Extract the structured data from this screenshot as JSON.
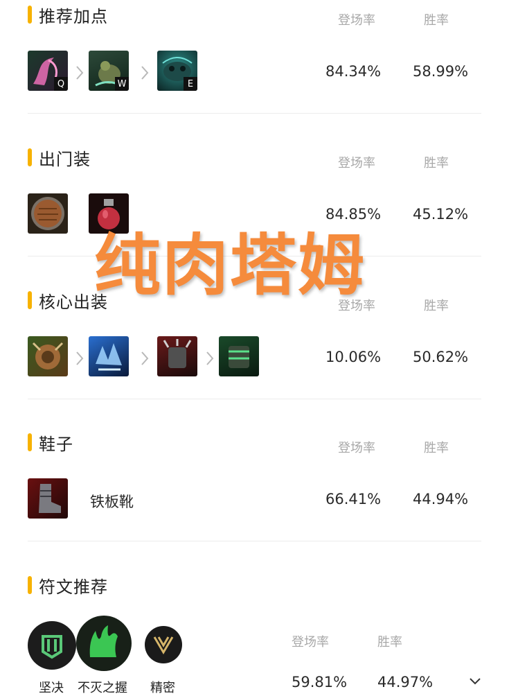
{
  "col_headers": {
    "pick_rate": "登场率",
    "win_rate": "胜率"
  },
  "skills": {
    "title": "推荐加点",
    "keys": [
      "Q",
      "W",
      "E"
    ],
    "pick_rate": "84.34%",
    "win_rate": "58.99%"
  },
  "starter": {
    "title": "出门装",
    "pick_rate": "84.85%",
    "win_rate": "45.12%"
  },
  "core": {
    "title": "核心出装",
    "pick_rate": "10.06%",
    "win_rate": "50.62%"
  },
  "boots": {
    "title": "鞋子",
    "item_name": "铁板靴",
    "pick_rate": "66.41%",
    "win_rate": "44.94%"
  },
  "runes": {
    "title": "符文推荐",
    "labels": [
      "坚决",
      "不灭之握",
      "精密"
    ],
    "pick_rate": "59.81%",
    "win_rate": "44.97%"
  },
  "overlay_text": "纯肉塔姆"
}
